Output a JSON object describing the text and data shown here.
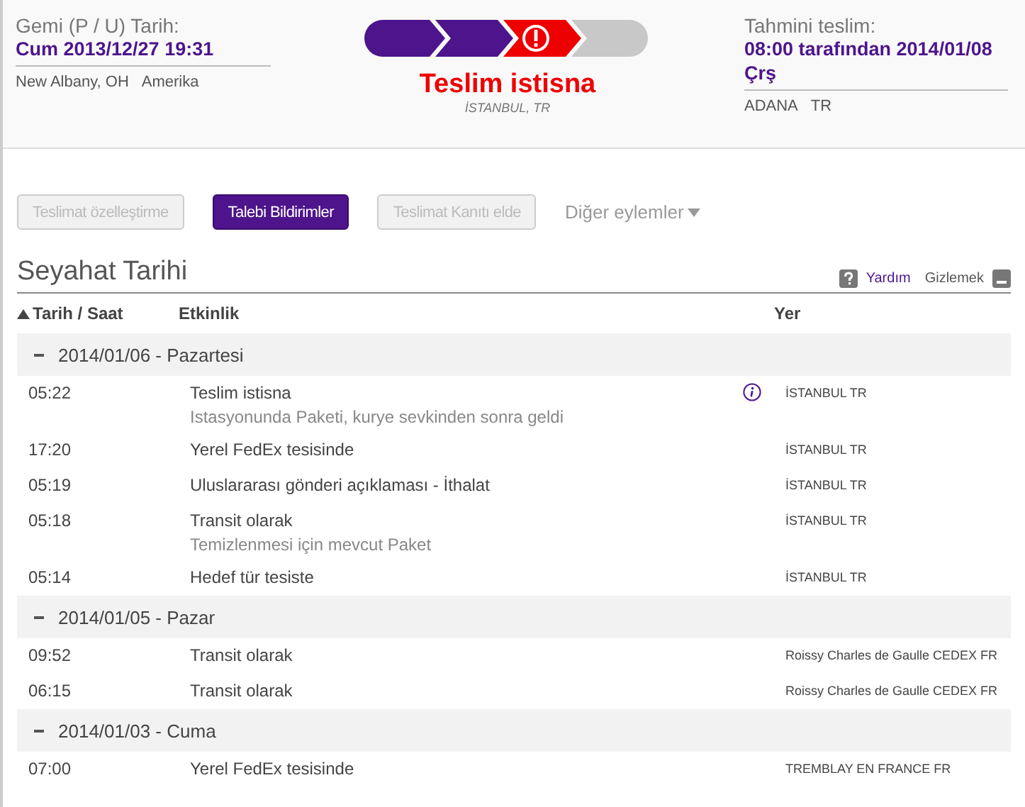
{
  "header": {
    "ship": {
      "label": "Gemi (P / U) Tarih:",
      "date": "Cum 2013/12/27 19:31",
      "place": "New Albany, OH",
      "country": "Amerika"
    },
    "progress": {
      "steps": [
        {
          "kind": "done"
        },
        {
          "kind": "done"
        },
        {
          "kind": "exception"
        },
        {
          "kind": "pending"
        }
      ],
      "status": "Teslim istisna",
      "location": "İSTANBUL, TR"
    },
    "delivery": {
      "label": "Tahmini teslim:",
      "date": "08:00 tarafından 2014/01/08 Çrş",
      "place": "ADANA",
      "country": "TR"
    }
  },
  "actions": [
    {
      "label": "Teslimat özelleştirme",
      "disabled": true
    },
    {
      "label": "Talebi Bildirimler",
      "disabled": false
    },
    {
      "label": "Teslimat Kanıtı elde",
      "disabled": true
    }
  ],
  "more_actions": "Diğer eylemler",
  "history": {
    "title": "Seyahat Tarihi",
    "help": "Yardım",
    "hide": "Gizlemek",
    "columns": [
      "Tarih / Saat",
      "Etkinlik",
      "Yer"
    ],
    "groups": [
      {
        "date": "2014/01/06 - Pazartesi",
        "expanded": true,
        "events": [
          {
            "time": "05:22",
            "activity": "Teslim istisna",
            "detail": "Istasyonunda Paketi, kurye sevkinden sonra geldi",
            "info": true,
            "location": "İSTANBUL TR"
          },
          {
            "time": "17:20",
            "activity": "Yerel FedEx tesisinde",
            "info": false,
            "location": "İSTANBUL TR"
          },
          {
            "time": "05:19",
            "activity": "Uluslararası gönderi açıklaması - İthalat",
            "info": false,
            "location": "İSTANBUL TR"
          },
          {
            "time": "05:18",
            "activity": "Transit olarak",
            "detail": "Temizlenmesi için mevcut Paket",
            "info": false,
            "location": "İSTANBUL TR"
          },
          {
            "time": "05:14",
            "activity": "Hedef tür tesiste",
            "info": false,
            "location": "İSTANBUL TR"
          }
        ]
      },
      {
        "date": "2014/01/05 - Pazar",
        "expanded": true,
        "events": [
          {
            "time": "09:52",
            "activity": "Transit olarak",
            "info": false,
            "location": "Roissy Charles de Gaulle CEDEX FR"
          },
          {
            "time": "06:15",
            "activity": "Transit olarak",
            "info": false,
            "location": "Roissy Charles de Gaulle CEDEX FR"
          }
        ]
      },
      {
        "date": "2014/01/03 - Cuma",
        "expanded": true,
        "events": [
          {
            "time": "07:00",
            "activity": "Yerel FedEx tesisinde",
            "info": false,
            "location": "TREMBLAY EN FRANCE FR"
          }
        ]
      }
    ]
  }
}
